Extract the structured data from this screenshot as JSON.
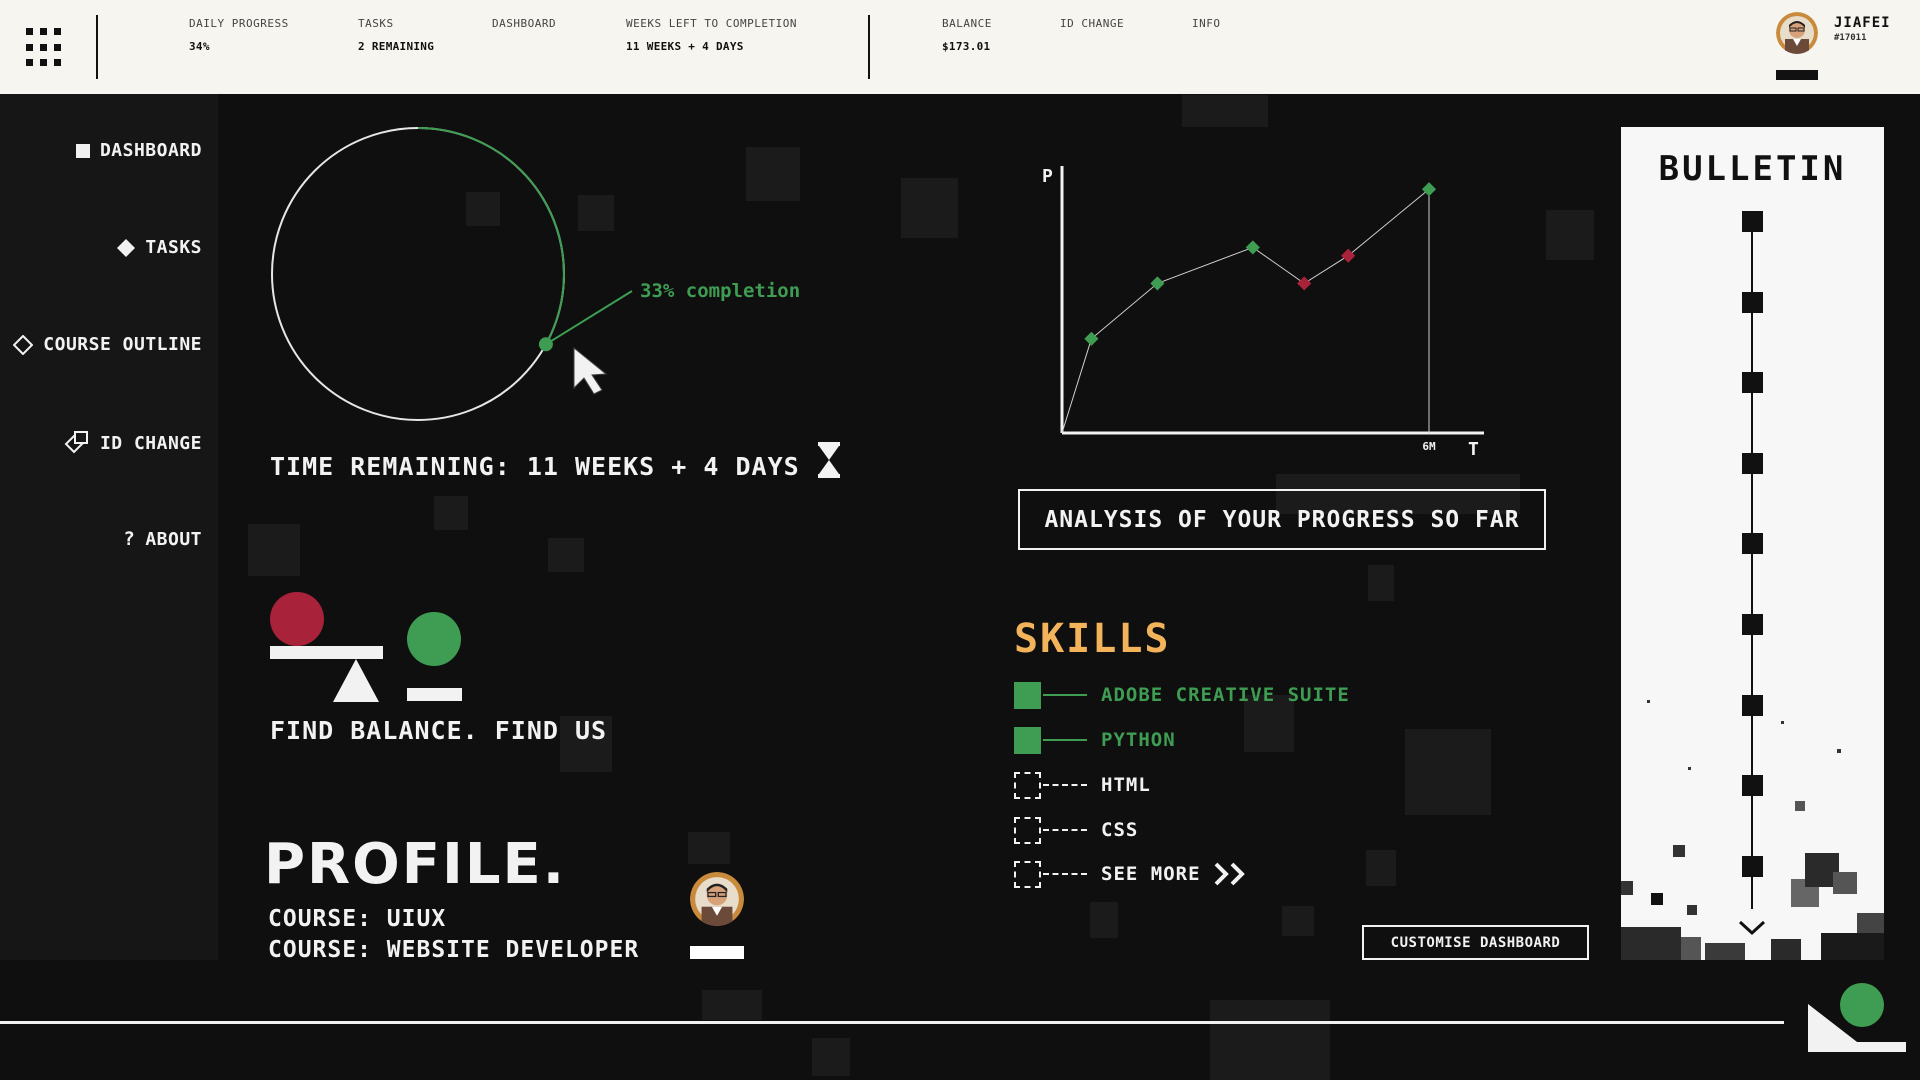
{
  "topbar": {
    "stats": [
      {
        "label": "DAILY PROGRESS",
        "value": "34%"
      },
      {
        "label": "TASKS",
        "value": "2 REMAINING"
      },
      {
        "label": "DASHBOARD",
        "value": ""
      },
      {
        "label": "WEEKS LEFT TO COMPLETION",
        "value": "11 WEEKS + 4 DAYS"
      },
      {
        "label": "BALANCE",
        "value": "$173.01"
      },
      {
        "label": "ID CHANGE",
        "value": ""
      },
      {
        "label": "INFO",
        "value": ""
      }
    ],
    "user": {
      "name": "JIAFEI",
      "id": "#17011"
    }
  },
  "sidebar": {
    "items": [
      {
        "label": "DASHBOARD",
        "icon": "square-icon"
      },
      {
        "label": "TASKS",
        "icon": "diamond-filled-icon"
      },
      {
        "label": "COURSE OUTLINE",
        "icon": "diamond-outline-icon"
      },
      {
        "label": "ID CHANGE",
        "icon": "id-change-icon"
      },
      {
        "label": "ABOUT",
        "icon": "question-icon"
      }
    ]
  },
  "progress": {
    "completion_fraction": 0.33,
    "completion_label": "33% completion",
    "time_remaining": "TIME REMAINING: 11 WEEKS + 4 DAYS"
  },
  "balance_text": "FIND BALANCE. FIND US",
  "profile": {
    "title": "PROFILE.",
    "courses": [
      "COURSE: UIUX",
      "COURSE: WEBSITE DEVELOPER"
    ]
  },
  "chart_data": {
    "type": "line",
    "ylabel": "P",
    "xlabel": "T",
    "x_tick_label": "6M",
    "points": [
      {
        "x": 0,
        "y": 0
      },
      {
        "x": 0.8,
        "y": 3.4
      },
      {
        "x": 2.6,
        "y": 5.4
      },
      {
        "x": 5.2,
        "y": 6.7
      },
      {
        "x": 6.6,
        "y": 5.4
      },
      {
        "x": 7.8,
        "y": 6.4
      },
      {
        "x": 10,
        "y": 8.8
      }
    ],
    "point_status": [
      "origin",
      "up",
      "up",
      "up",
      "down",
      "down",
      "up"
    ],
    "xlim": [
      0,
      11.5
    ],
    "ylim": [
      0,
      10
    ]
  },
  "analysis_label": "ANALYSIS OF YOUR PROGRESS SO FAR",
  "skills": {
    "title": "SKILLS",
    "items": [
      {
        "label": "ADOBE CREATIVE SUITE",
        "done": true
      },
      {
        "label": "PYTHON",
        "done": true
      },
      {
        "label": "HTML",
        "done": false
      },
      {
        "label": "CSS",
        "done": false
      },
      {
        "label": "SEE MORE",
        "done": false
      }
    ]
  },
  "customise_label": "CUSTOMISE DASHBOARD",
  "bulletin": {
    "title": "BULLETIN",
    "node_count": 9
  },
  "colors": {
    "green": "#3e9d52",
    "red": "#a8223a",
    "orange": "#f2b35a",
    "cream": "#f7f5ef"
  }
}
